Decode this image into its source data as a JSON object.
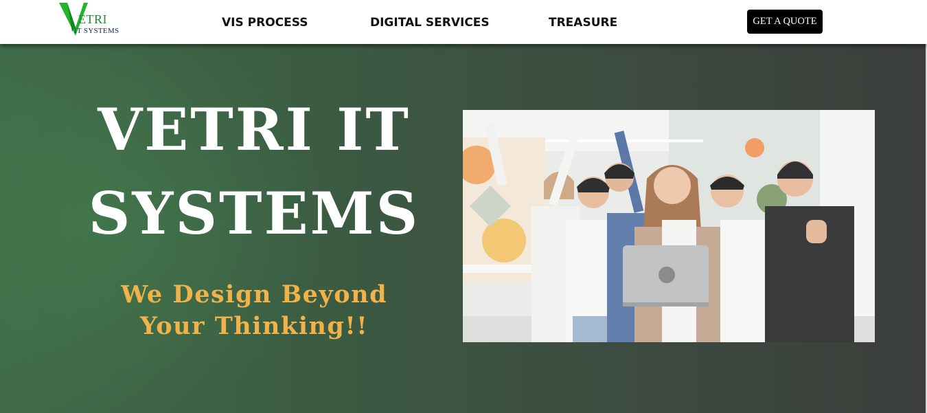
{
  "header": {
    "logo": {
      "mark": "V",
      "word": "ETRI",
      "subtitle": "IT SYSTEMS"
    },
    "nav": [
      {
        "label": "VIS PROCESS"
      },
      {
        "label": "DIGITAL SERVICES"
      },
      {
        "label": "TREASURE"
      }
    ],
    "cta_label": "GET A QUOTE"
  },
  "hero": {
    "title_line1": "VETRI IT",
    "title_line2": "SYSTEMS",
    "tagline_line1": "We Design Beyond",
    "tagline_line2": "Your Thinking!!",
    "image": {
      "icon": "team-celebration-photo"
    }
  },
  "colors": {
    "brand_green": "#22b42c",
    "tagline_gold": "#f1b24a",
    "cta_background": "#000000"
  }
}
